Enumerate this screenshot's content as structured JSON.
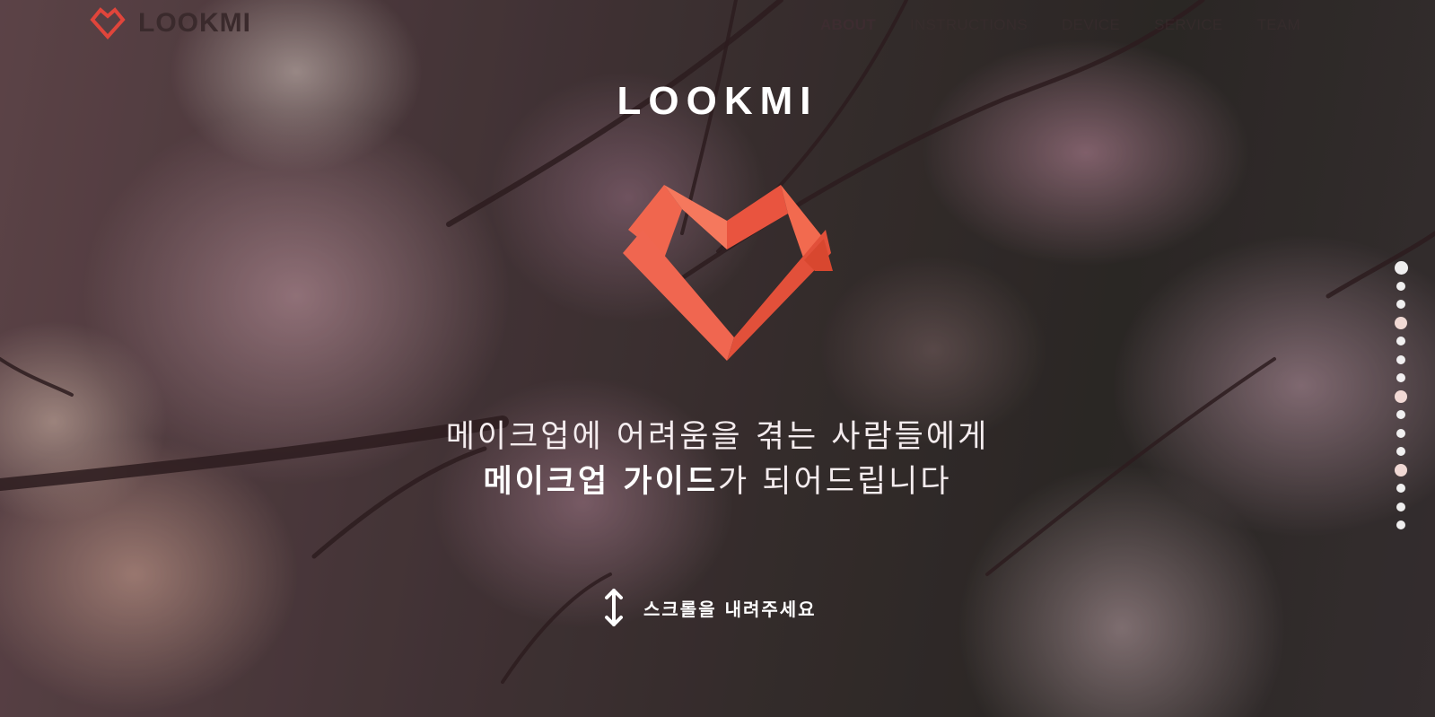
{
  "brand": {
    "name": "LOOKMI"
  },
  "nav": {
    "items": [
      {
        "label": "ABOUT",
        "active": true
      },
      {
        "label": "INSTRUCTIONS",
        "active": false
      },
      {
        "label": "DEVICE",
        "active": false
      },
      {
        "label": "SERVICE",
        "active": false
      },
      {
        "label": "TEAM",
        "active": false
      }
    ]
  },
  "hero": {
    "title": "LOOKMI",
    "tagline_line1": "메이크업에 어려움을 겪는 사람들에게",
    "tagline_line2_bold": "메이크업 가이드",
    "tagline_line2_rest": "가 되어드립니다",
    "scroll_hint": "스크롤을 내려주세요"
  },
  "section_dots": {
    "count": 15,
    "active_index": 0
  },
  "colors": {
    "accent": "#f26a4f",
    "accent_dark": "#d94a35",
    "nav_text": "#3d2c30"
  },
  "icons": {
    "brand_logo": "heart-logo-icon",
    "hero_logo": "heart-logo-icon",
    "scroll": "vertical-arrow-icon"
  }
}
